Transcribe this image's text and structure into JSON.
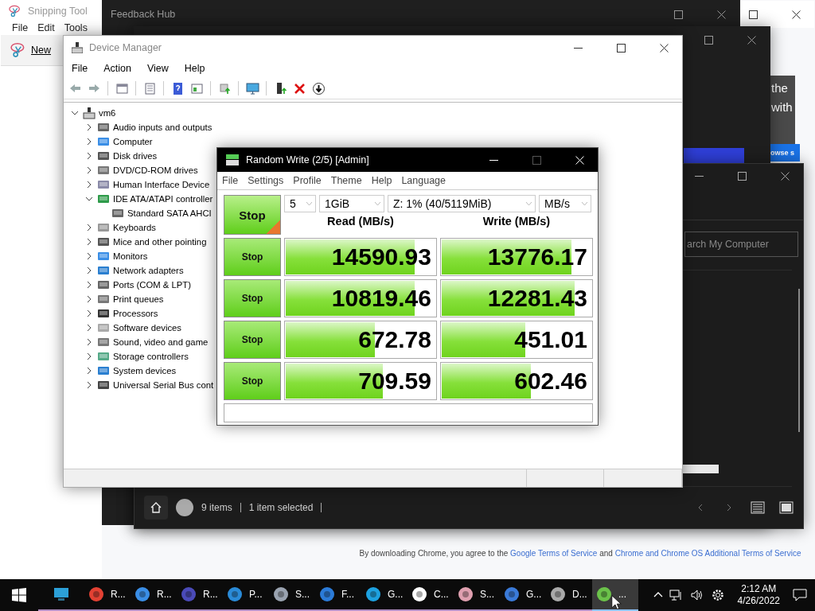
{
  "chrome_page": {
    "hero_lines": [
      "the",
      "with"
    ],
    "hero_button": "owse s",
    "footer": [
      {
        "text": "By downloading Chrome, you agree to the",
        "link": false
      },
      {
        "text": "Google Terms of Service",
        "link": true
      },
      {
        "text": "and",
        "link": false
      },
      {
        "text": "Chrome and Chrome OS Additional Terms of Service",
        "link": true
      }
    ]
  },
  "snipping_tool": {
    "title": "Snipping Tool",
    "menu": [
      "File",
      "Edit",
      "Tools"
    ],
    "new_button": "New"
  },
  "feedback_hub": {
    "title": "Feedback Hub"
  },
  "file_explorer": {
    "search": {
      "placeholder": "arch My Computer"
    },
    "status": [
      "9 items",
      "1 item selected"
    ]
  },
  "device_manager": {
    "title": "Device Manager",
    "menu": [
      "File",
      "Action",
      "View",
      "Help"
    ],
    "tree": {
      "label": "vm6",
      "expanded": true,
      "children": [
        {
          "label": "Audio inputs and outputs",
          "expanded": false
        },
        {
          "label": "Computer",
          "expanded": false
        },
        {
          "label": "Disk drives",
          "expanded": false
        },
        {
          "label": "DVD/CD-ROM drives",
          "expanded": false
        },
        {
          "label": "Human Interface Device",
          "expanded": false
        },
        {
          "label": "IDE ATA/ATAPI controller",
          "expanded": true,
          "children": [
            {
              "label": "Standard SATA AHCI"
            }
          ]
        },
        {
          "label": "Keyboards",
          "expanded": false
        },
        {
          "label": "Mice and other pointing",
          "expanded": false
        },
        {
          "label": "Monitors",
          "expanded": false
        },
        {
          "label": "Network adapters",
          "expanded": false
        },
        {
          "label": "Ports (COM & LPT)",
          "expanded": false
        },
        {
          "label": "Print queues",
          "expanded": false
        },
        {
          "label": "Processors",
          "expanded": false
        },
        {
          "label": "Software devices",
          "expanded": false
        },
        {
          "label": "Sound, video and game",
          "expanded": false
        },
        {
          "label": "Storage controllers",
          "expanded": false
        },
        {
          "label": "System devices",
          "expanded": false
        },
        {
          "label": "Universal Serial Bus cont",
          "expanded": false
        }
      ]
    }
  },
  "diskmark": {
    "title": "Random Write (2/5) [Admin]",
    "menu": [
      "File",
      "Settings",
      "Profile",
      "Theme",
      "Help",
      "Language"
    ],
    "stop_all": "Stop",
    "selects": [
      "5",
      "1GiB",
      "Z: 1% (40/5119MiB)",
      "MB/s"
    ],
    "headers": [
      "Read (MB/s)",
      "Write (MB/s)"
    ],
    "rows": [
      {
        "button": "Stop",
        "read": {
          "value": "14590.93",
          "level": 0.85
        },
        "write": {
          "value": "13776.17",
          "level": 0.86
        }
      },
      {
        "button": "Stop",
        "read": {
          "value": "10819.46",
          "level": 0.85
        },
        "write": {
          "value": "12281.43",
          "level": 0.88
        }
      },
      {
        "button": "Stop",
        "read": {
          "value": "672.78",
          "level": 0.59
        },
        "write": {
          "value": "451.01",
          "level": 0.55
        }
      },
      {
        "button": "Stop",
        "read": {
          "value": "709.59",
          "level": 0.64
        },
        "write": {
          "value": "602.46",
          "level": 0.59
        }
      }
    ]
  },
  "taskbar": {
    "apps": [
      {
        "selected": false
      },
      {
        "label": "R...",
        "selected": false
      },
      {
        "label": "R...",
        "selected": false
      },
      {
        "label": "R...",
        "selected": false
      },
      {
        "label": "P...",
        "selected": false
      },
      {
        "label": "S...",
        "selected": false
      },
      {
        "label": "F...",
        "selected": false
      },
      {
        "label": "G...",
        "selected": false
      },
      {
        "label": "C...",
        "selected": false
      },
      {
        "label": "S...",
        "selected": false
      },
      {
        "label": "G...",
        "selected": false
      },
      {
        "label": "D...",
        "selected": false
      },
      {
        "label": "...",
        "selected": true
      }
    ],
    "time": "2:12 AM",
    "date": "4/26/2022"
  }
}
